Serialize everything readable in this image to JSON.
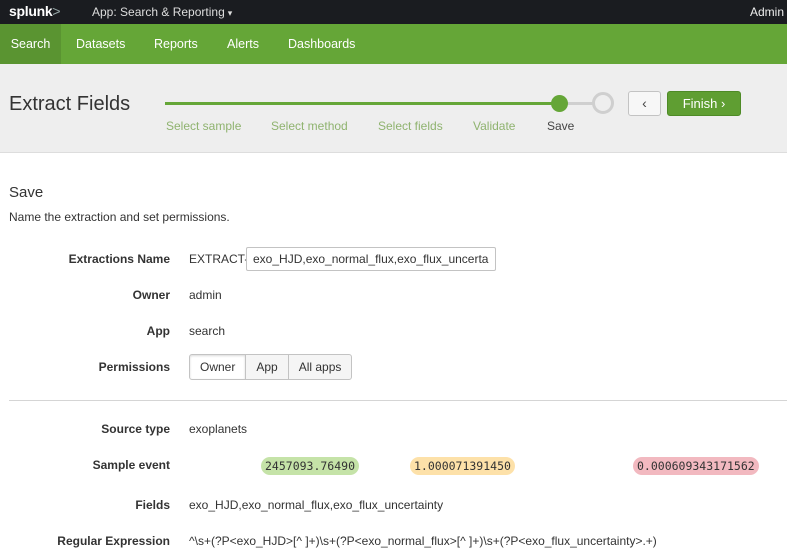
{
  "topbar": {
    "logo": "splunk",
    "logo_suffix": ">",
    "app_menu": "App: Search & Reporting",
    "app_menu_icon": "chevron-down-icon",
    "user": "Admin"
  },
  "nav": {
    "items": [
      "Search",
      "Datasets",
      "Reports",
      "Alerts",
      "Dashboards"
    ],
    "active": "Search"
  },
  "wizard": {
    "title": "Extract Fields",
    "steps": [
      "Select sample",
      "Select method",
      "Select fields",
      "Validate",
      "Save"
    ],
    "current_step": "Save",
    "back_label": "<",
    "finish_label": "Finish ›"
  },
  "save": {
    "title": "Save",
    "description": "Name the extraction and set permissions.",
    "extraction_name_label": "Extractions Name",
    "extraction_prefix": "EXTRACT-",
    "extraction_name_value": "exo_HJD,exo_normal_flux,exo_flux_uncertainty",
    "owner_label": "Owner",
    "owner_value": "admin",
    "app_label": "App",
    "app_value": "search",
    "permissions_label": "Permissions",
    "permissions_options": [
      "Owner",
      "App",
      "All apps"
    ],
    "permissions_selected": "Owner"
  },
  "details": {
    "source_type_label": "Source type",
    "source_type_value": "exoplanets",
    "sample_event_label": "Sample event",
    "sample_tokens": [
      {
        "text": "2457093.76490",
        "color": "#c5e3a8"
      },
      {
        "text": "1.000071391450",
        "color": "#fde1a9"
      },
      {
        "text": "0.000609343171562",
        "color": "#f2b9c0"
      }
    ],
    "fields_label": "Fields",
    "fields_value": "exo_HJD,exo_normal_flux,exo_flux_uncertainty",
    "regex_label": "Regular Expression",
    "regex_value": "^\\s+(?P<exo_HJD>[^ ]+)\\s+(?P<exo_normal_flux>[^ ]+)\\s+(?P<exo_flux_uncertainty>.+)"
  },
  "colors": {
    "nav_green": "#65a637",
    "topbar": "#1a1c20",
    "header_bg": "#eeeeee"
  }
}
